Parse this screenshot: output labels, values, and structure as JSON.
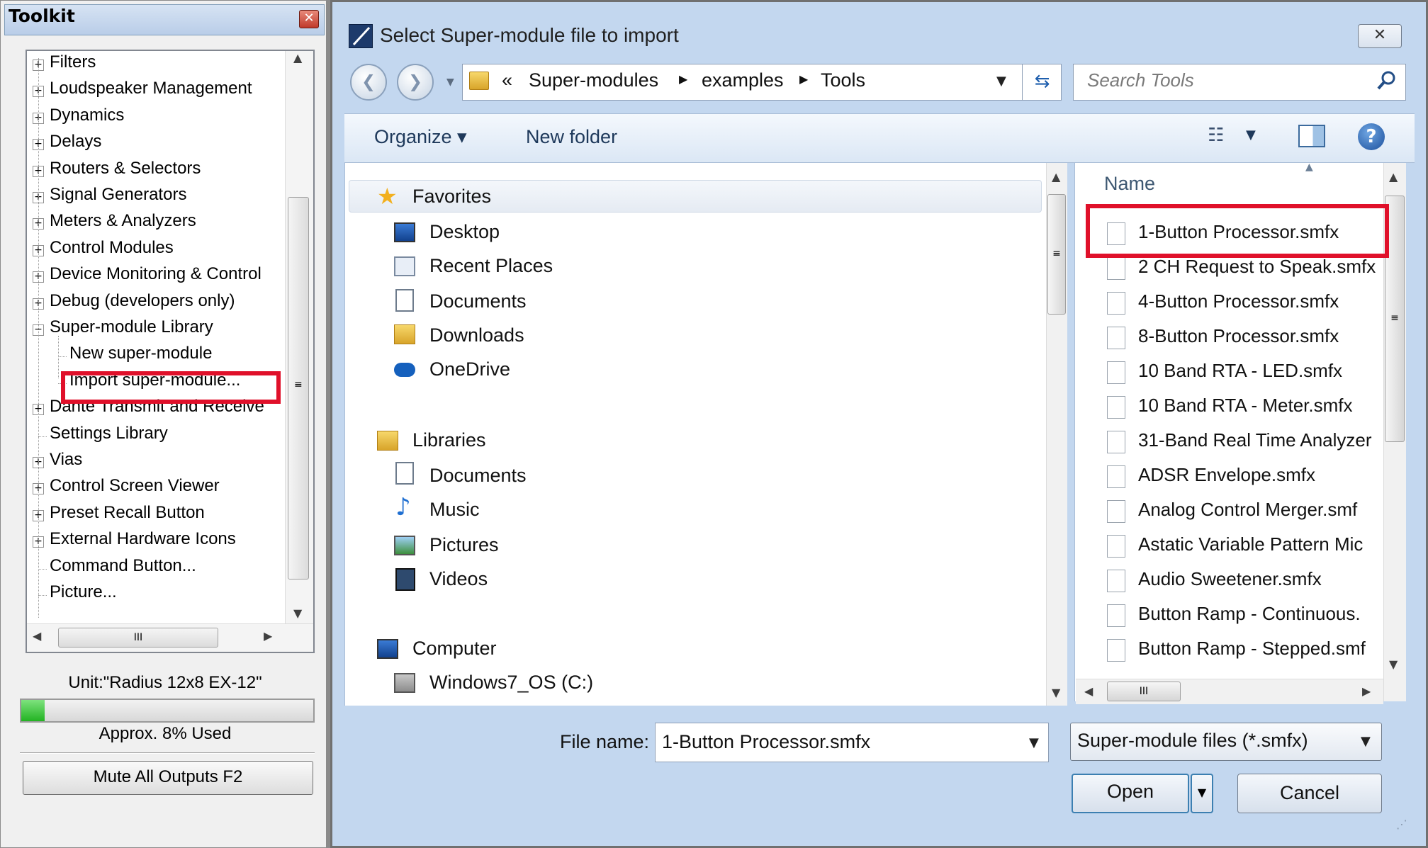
{
  "toolkit": {
    "title": "Toolkit",
    "tree": [
      {
        "label": "Filters",
        "expander": "+"
      },
      {
        "label": "Loudspeaker Management",
        "expander": "+"
      },
      {
        "label": "Dynamics",
        "expander": "+"
      },
      {
        "label": "Delays",
        "expander": "+"
      },
      {
        "label": "Routers & Selectors",
        "expander": "+"
      },
      {
        "label": "Signal Generators",
        "expander": "+"
      },
      {
        "label": "Meters & Analyzers",
        "expander": "+"
      },
      {
        "label": "Control Modules",
        "expander": "+"
      },
      {
        "label": "Device Monitoring & Control",
        "expander": "+"
      },
      {
        "label": "Debug (developers only)",
        "expander": "+"
      },
      {
        "label": "Super-module Library",
        "expander": "−"
      },
      {
        "label": "New super-module",
        "expander": ""
      },
      {
        "label": "Import super-module...",
        "expander": ""
      },
      {
        "label": "Dante Transmit and Receive",
        "expander": "+"
      },
      {
        "label": "Settings Library",
        "expander": ""
      },
      {
        "label": "Vias",
        "expander": "+"
      },
      {
        "label": "Control Screen Viewer",
        "expander": "+"
      },
      {
        "label": "Preset Recall Button",
        "expander": "+"
      },
      {
        "label": "External Hardware Icons",
        "expander": "+"
      },
      {
        "label": "Command Button...",
        "expander": ""
      },
      {
        "label": "Picture...",
        "expander": ""
      }
    ],
    "hscroll_grip": "III",
    "vscroll_grip": "≡",
    "unit": "Unit:\"Radius 12x8 EX-12\"",
    "usage_fraction": 0.08,
    "usage_label": "Approx.  8% Used",
    "mute_button": "Mute All Outputs  F2"
  },
  "dialog": {
    "title": "Select Super-module file to import",
    "close": "✕",
    "breadcrumb": [
      "«",
      "Super-modules",
      "examples",
      "Tools"
    ],
    "search_placeholder": "Search Tools",
    "toolbar": {
      "organize": "Organize ▾",
      "new_folder": "New folder"
    },
    "nav": {
      "favorites": "Favorites",
      "favorites_items": [
        "Desktop",
        "Recent Places",
        "Documents",
        "Downloads",
        "OneDrive"
      ],
      "libraries": "Libraries",
      "libraries_items": [
        "Documents",
        "Music",
        "Pictures",
        "Videos"
      ],
      "computer": "Computer",
      "computer_items": [
        "Windows7_OS (C:)"
      ]
    },
    "column_header": "Name",
    "files": [
      "1-Button Processor.smfx",
      "2 CH Request to Speak.smfx",
      "4-Button Processor.smfx",
      "8-Button Processor.smfx",
      "10 Band RTA - LED.smfx",
      "10 Band RTA - Meter.smfx",
      "31-Band Real Time Analyzer",
      "ADSR Envelope.smfx",
      "Analog Control Merger.smf",
      "Astatic Variable Pattern Mic",
      "Audio Sweetener.smfx",
      "Button Ramp - Continuous.",
      "Button Ramp - Stepped.smf"
    ],
    "file_name_label": "File name:",
    "file_name_value": "1-Button Processor.smfx",
    "file_type": "Super-module files (*.smfx)",
    "open": "Open",
    "cancel": "Cancel"
  },
  "colors": {
    "highlight": "#e0102a",
    "accent": "#1e395b",
    "progress": "#22b322"
  }
}
